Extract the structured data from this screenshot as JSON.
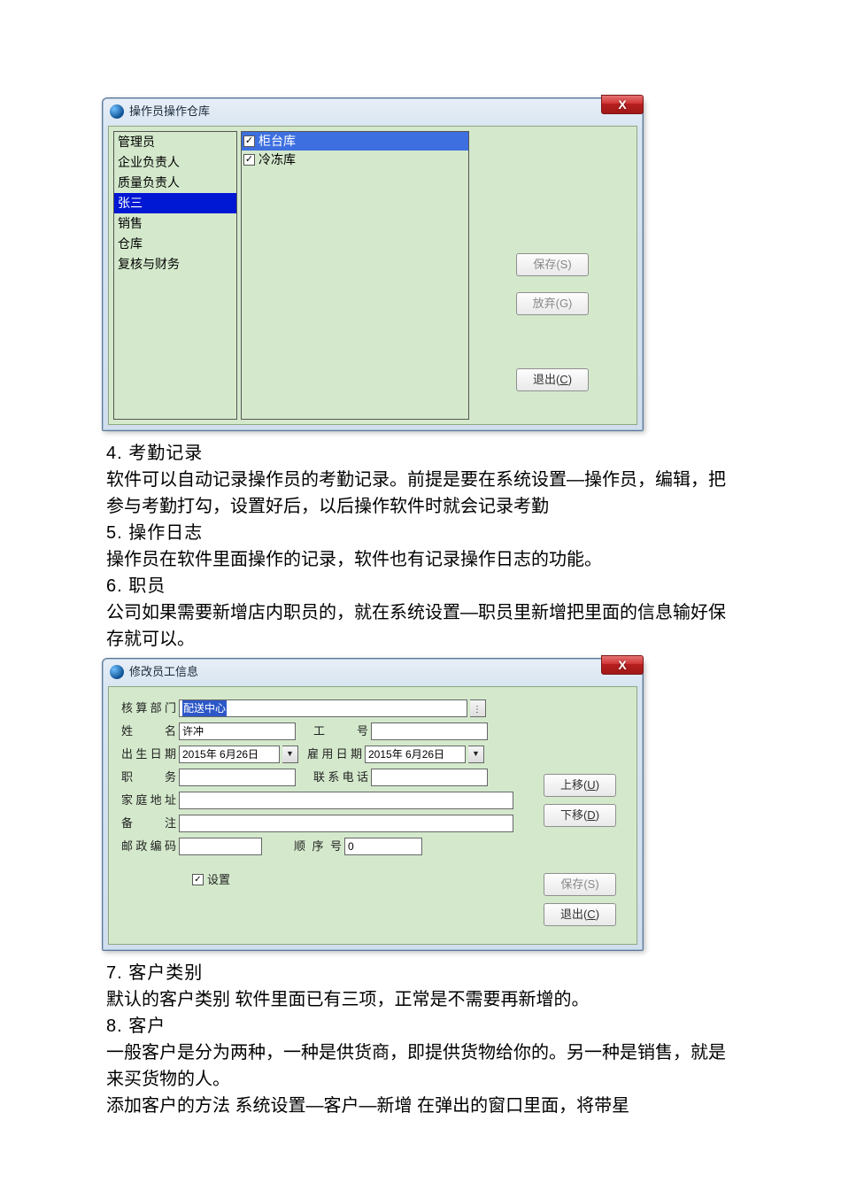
{
  "dialog1": {
    "title": "操作员操作仓库",
    "close_x": "X",
    "left_items": [
      "管理员",
      "企业负责人",
      "质量负责人",
      "张三",
      "销售",
      "仓库",
      "复核与财务"
    ],
    "left_selected_index": 3,
    "mid_items": [
      "柜台库",
      "冷冻库"
    ],
    "mid_selected_index": 0,
    "btn_save": "保存(S)",
    "btn_discard": "放弃(G)",
    "btn_exit": "退出(C)",
    "btn_exit_accel": "C"
  },
  "text": {
    "h4": "4. 考勤记录",
    "p4a": "软件可以自动记录操作员的考勤记录。前提是要在系统设置—操作员，编辑，把参与考勤打勾，设置好后，以后操作软件时就会记录考勤",
    "h5": "5. 操作日志",
    "p5": "操作员在软件里面操作的记录，软件也有记录操作日志的功能。",
    "h6": "6. 职员",
    "p6": "公司如果需要新增店内职员的，就在系统设置—职员里新增把里面的信息输好保存就可以。",
    "h7": "7. 客户类别",
    "p7": "默认的客户类别 软件里面已有三项，正常是不需要再新增的。",
    "h8": "8. 客户",
    "p8a": "一般客户是分为两种，一种是供货商，即提供货物给你的。另一种是销售，就是来买货物的人。",
    "p8b": "添加客户的方法 系统设置—客户—新增 在弹出的窗口里面，将带星"
  },
  "dialog2": {
    "title": "修改员工信息",
    "close_x": "X",
    "labels": {
      "dept": "核算部门",
      "name": "姓　　名",
      "empno": "工　　号",
      "dob": "出生日期",
      "hiredate": "雇用日期",
      "job": "职　　务",
      "phone": "联系电话",
      "addr": "家庭地址",
      "note": "备　　注",
      "postcode": "邮政编码",
      "seq": "顺 序 号"
    },
    "values": {
      "dept": "配送中心",
      "name": "许冲",
      "empno": "",
      "dob": "2015年 6月26日",
      "hiredate": "2015年 6月26日",
      "job": "",
      "phone": "",
      "addr": "",
      "note": "",
      "postcode": "",
      "seq": "0"
    },
    "chk_label": "设置",
    "btn_up": "上移(U)",
    "btn_down": "下移(D)",
    "btn_save": "保存(S)",
    "btn_exit": "退出(C)"
  }
}
